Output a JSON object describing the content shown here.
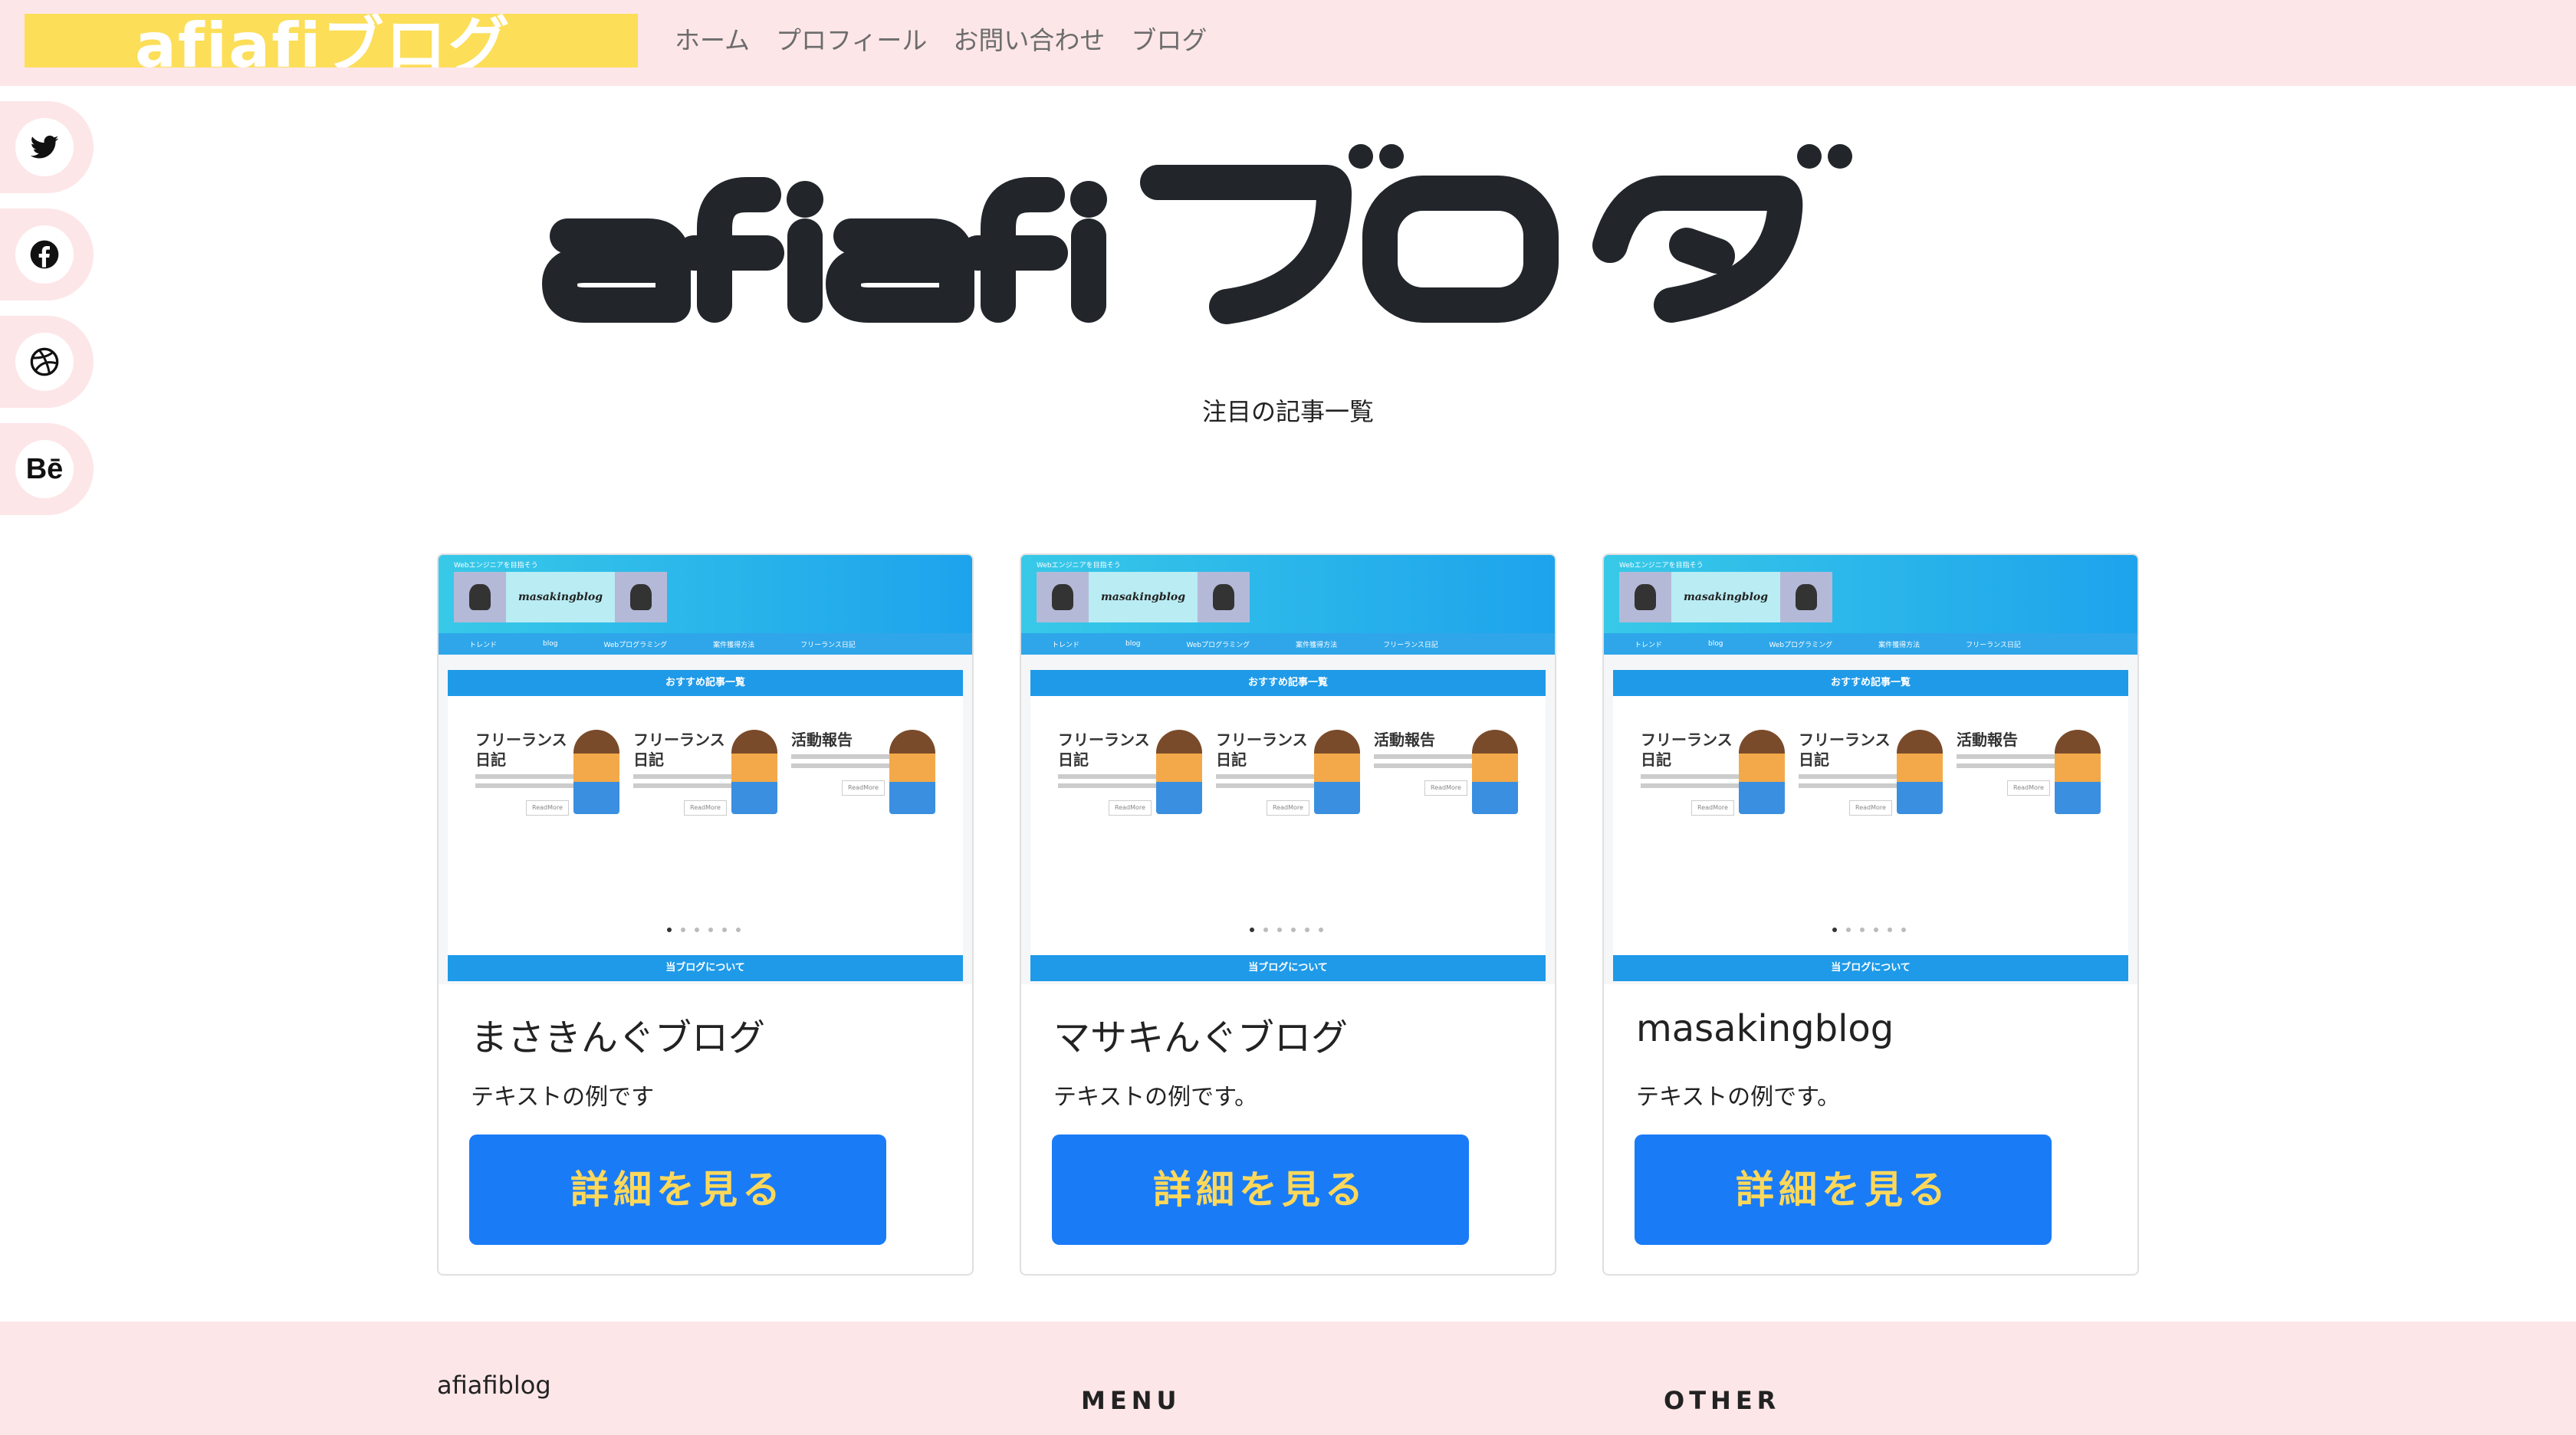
{
  "header": {
    "brand": "afiafiブログ",
    "nav": [
      "ホーム",
      "プロフィール",
      "お問い合わせ",
      "ブログ"
    ]
  },
  "social": [
    "twitter-icon",
    "facebook-icon",
    "dribbble-icon",
    "behance-icon"
  ],
  "social_behance_text": "Bē",
  "hero": {
    "logo_text": "afiafiブログ"
  },
  "featured_heading": "注目の記事一覧",
  "thumbnail": {
    "site_name": "masakingblog",
    "top_text": "Webエンジニアを目指そう",
    "menu": [
      "トレンド",
      "blog",
      "Webプログラミング",
      "案件獲得方法",
      "フリーランス日記"
    ],
    "section_title": "おすすめ記事一覧",
    "bottom_bar": "当ブログについて",
    "posts": [
      "フリーランス日記",
      "フリーランス日記",
      "活動報告"
    ],
    "readmore": "ReadMore"
  },
  "cards": [
    {
      "title": "まさきんぐブログ",
      "text": "テキストの例です",
      "button": "詳細を見る"
    },
    {
      "title": "マサキんぐブログ",
      "text": "テキストの例です。",
      "button": "詳細を見る"
    },
    {
      "title": "masakingblog",
      "text": "テキストの例です。",
      "button": "詳細を見る"
    }
  ],
  "footer": {
    "brand": "afiafiblog",
    "menu": "MENU",
    "other": "OTHER"
  },
  "colors": {
    "pink": "#fde6e8",
    "yellow": "#fcde58",
    "blue": "#1a7bf7",
    "btn_text": "#fcd85a"
  }
}
